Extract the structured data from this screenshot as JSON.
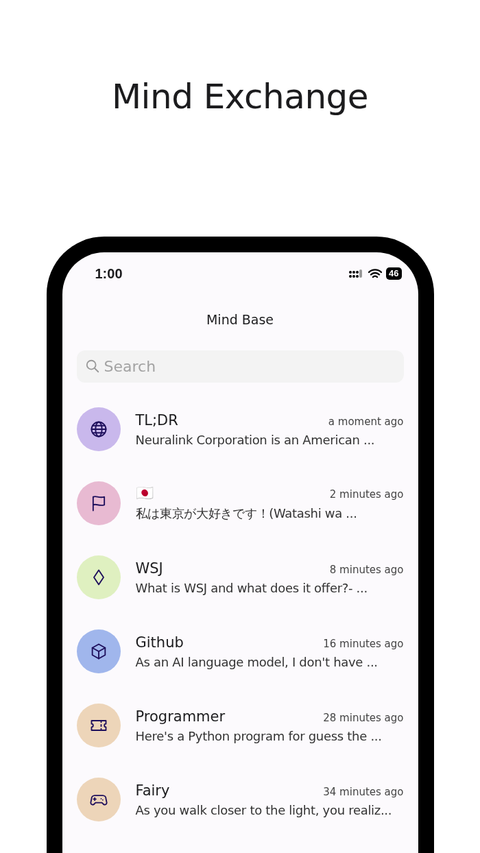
{
  "page_title": "Mind Exchange",
  "status_bar": {
    "time": "1:00",
    "battery": "46"
  },
  "header": {
    "title": "Mind Base"
  },
  "search": {
    "placeholder": "Search"
  },
  "chats": [
    {
      "title": "TL;DR",
      "time": "a moment ago",
      "preview": "Neuralink Corporation is an American ...",
      "color": "#c9b8ec",
      "kind": "globe"
    },
    {
      "title": "🇯🇵",
      "time": "2 minutes ago",
      "preview": "私は東京が大好きです！(Watashi wa ...",
      "color": "#e8bad2",
      "kind": "flag"
    },
    {
      "title": "WSJ",
      "time": "8 minutes ago",
      "preview": "What is WSJ and what does it offer?- ...",
      "color": "#dff0c0",
      "kind": "diamond"
    },
    {
      "title": "Github",
      "time": "16 minutes ago",
      "preview": "As an AI language model, I don't have ...",
      "color": "#a0b6ec",
      "kind": "cube"
    },
    {
      "title": "Programmer",
      "time": "28 minutes ago",
      "preview": "Here's a Python program for guess the ...",
      "color": "#edd5b9",
      "kind": "ticket"
    },
    {
      "title": "Fairy",
      "time": "34 minutes ago",
      "preview": "As you walk closer to the light, you realiz...",
      "color": "#edd5b9",
      "kind": "gamepad"
    }
  ]
}
